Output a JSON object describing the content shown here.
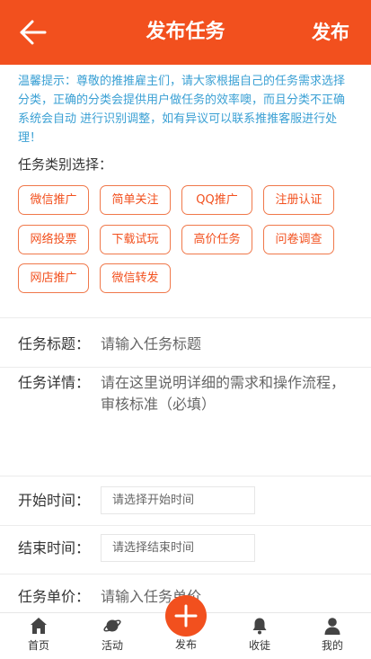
{
  "header": {
    "title": "发布任务",
    "publish_label": "发布"
  },
  "tip": {
    "text": "温馨提示：尊敬的推推雇主们，请大家根据自己的任务需求选择分类，正确的分类会提供用户做任务的效率噢，而且分类不正确系统会自动 进行识别调整，如有异议可以联系推推客服进行处理！"
  },
  "category": {
    "label": "任务类别选择：",
    "tags": [
      "微信推广",
      "简单关注",
      "QQ推广",
      "注册认证",
      "网络投票",
      "下载试玩",
      "高价任务",
      "问卷调查",
      "网店推广",
      "微信转发"
    ]
  },
  "form": {
    "title_label": "任务标题：",
    "title_placeholder": "请输入任务标题",
    "detail_label": "任务详情：",
    "detail_placeholder": "请在这里说明详细的需求和操作流程，审核标准（必填）",
    "start_label": "开始时间：",
    "start_placeholder": "请选择开始时间",
    "end_label": "结束时间：",
    "end_placeholder": "请选择结束时间",
    "price_label": "任务单价：",
    "price_placeholder": "请输入任务单价"
  },
  "nav": {
    "items": [
      {
        "label": "首页",
        "icon": "home-icon"
      },
      {
        "label": "活动",
        "icon": "planet-icon"
      },
      {
        "label": "发布",
        "icon": "plus-icon"
      },
      {
        "label": "收徒",
        "icon": "bell-icon"
      },
      {
        "label": "我的",
        "icon": "user-icon"
      }
    ]
  },
  "colors": {
    "accent": "#f2501e",
    "tip_text": "#3aa0d4",
    "nav_icon": "#444444"
  }
}
